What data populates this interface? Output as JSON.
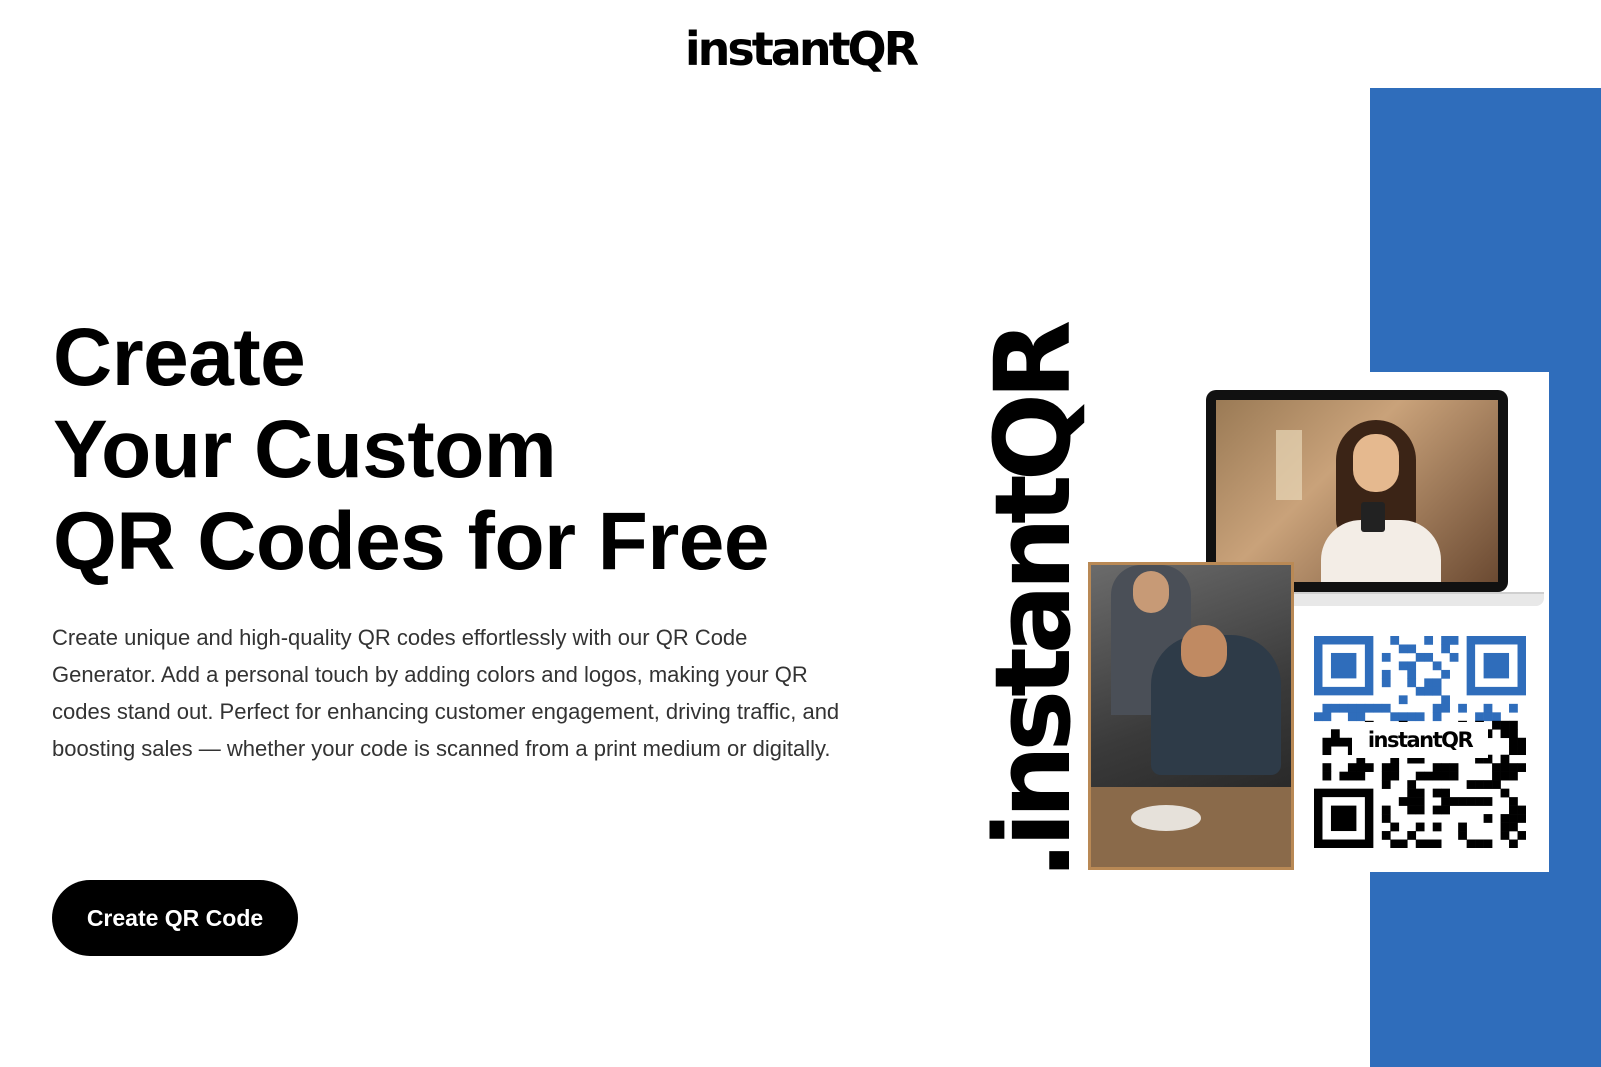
{
  "header": {
    "logo_text": "instantQR"
  },
  "hero": {
    "title_lines": [
      "Create",
      "Your Custom",
      "QR Codes for Free"
    ],
    "description": "Create unique and high-quality QR codes effortlessly with our QR Code Generator. Add a personal touch by adding colors and logos, making your QR codes stand out. Perfect for enhancing customer engagement, driving traffic, and boosting sales — whether your code is scanned from a print medium or digitally.",
    "cta_label": "Create QR Code"
  },
  "showcase": {
    "vertical_brand": ".instantQR",
    "qr_center_label": "instantQR",
    "colors": {
      "accent_blue": "#2f6dbb",
      "qr_color": "#2f6dbb",
      "frame_brown": "#b98955"
    }
  }
}
